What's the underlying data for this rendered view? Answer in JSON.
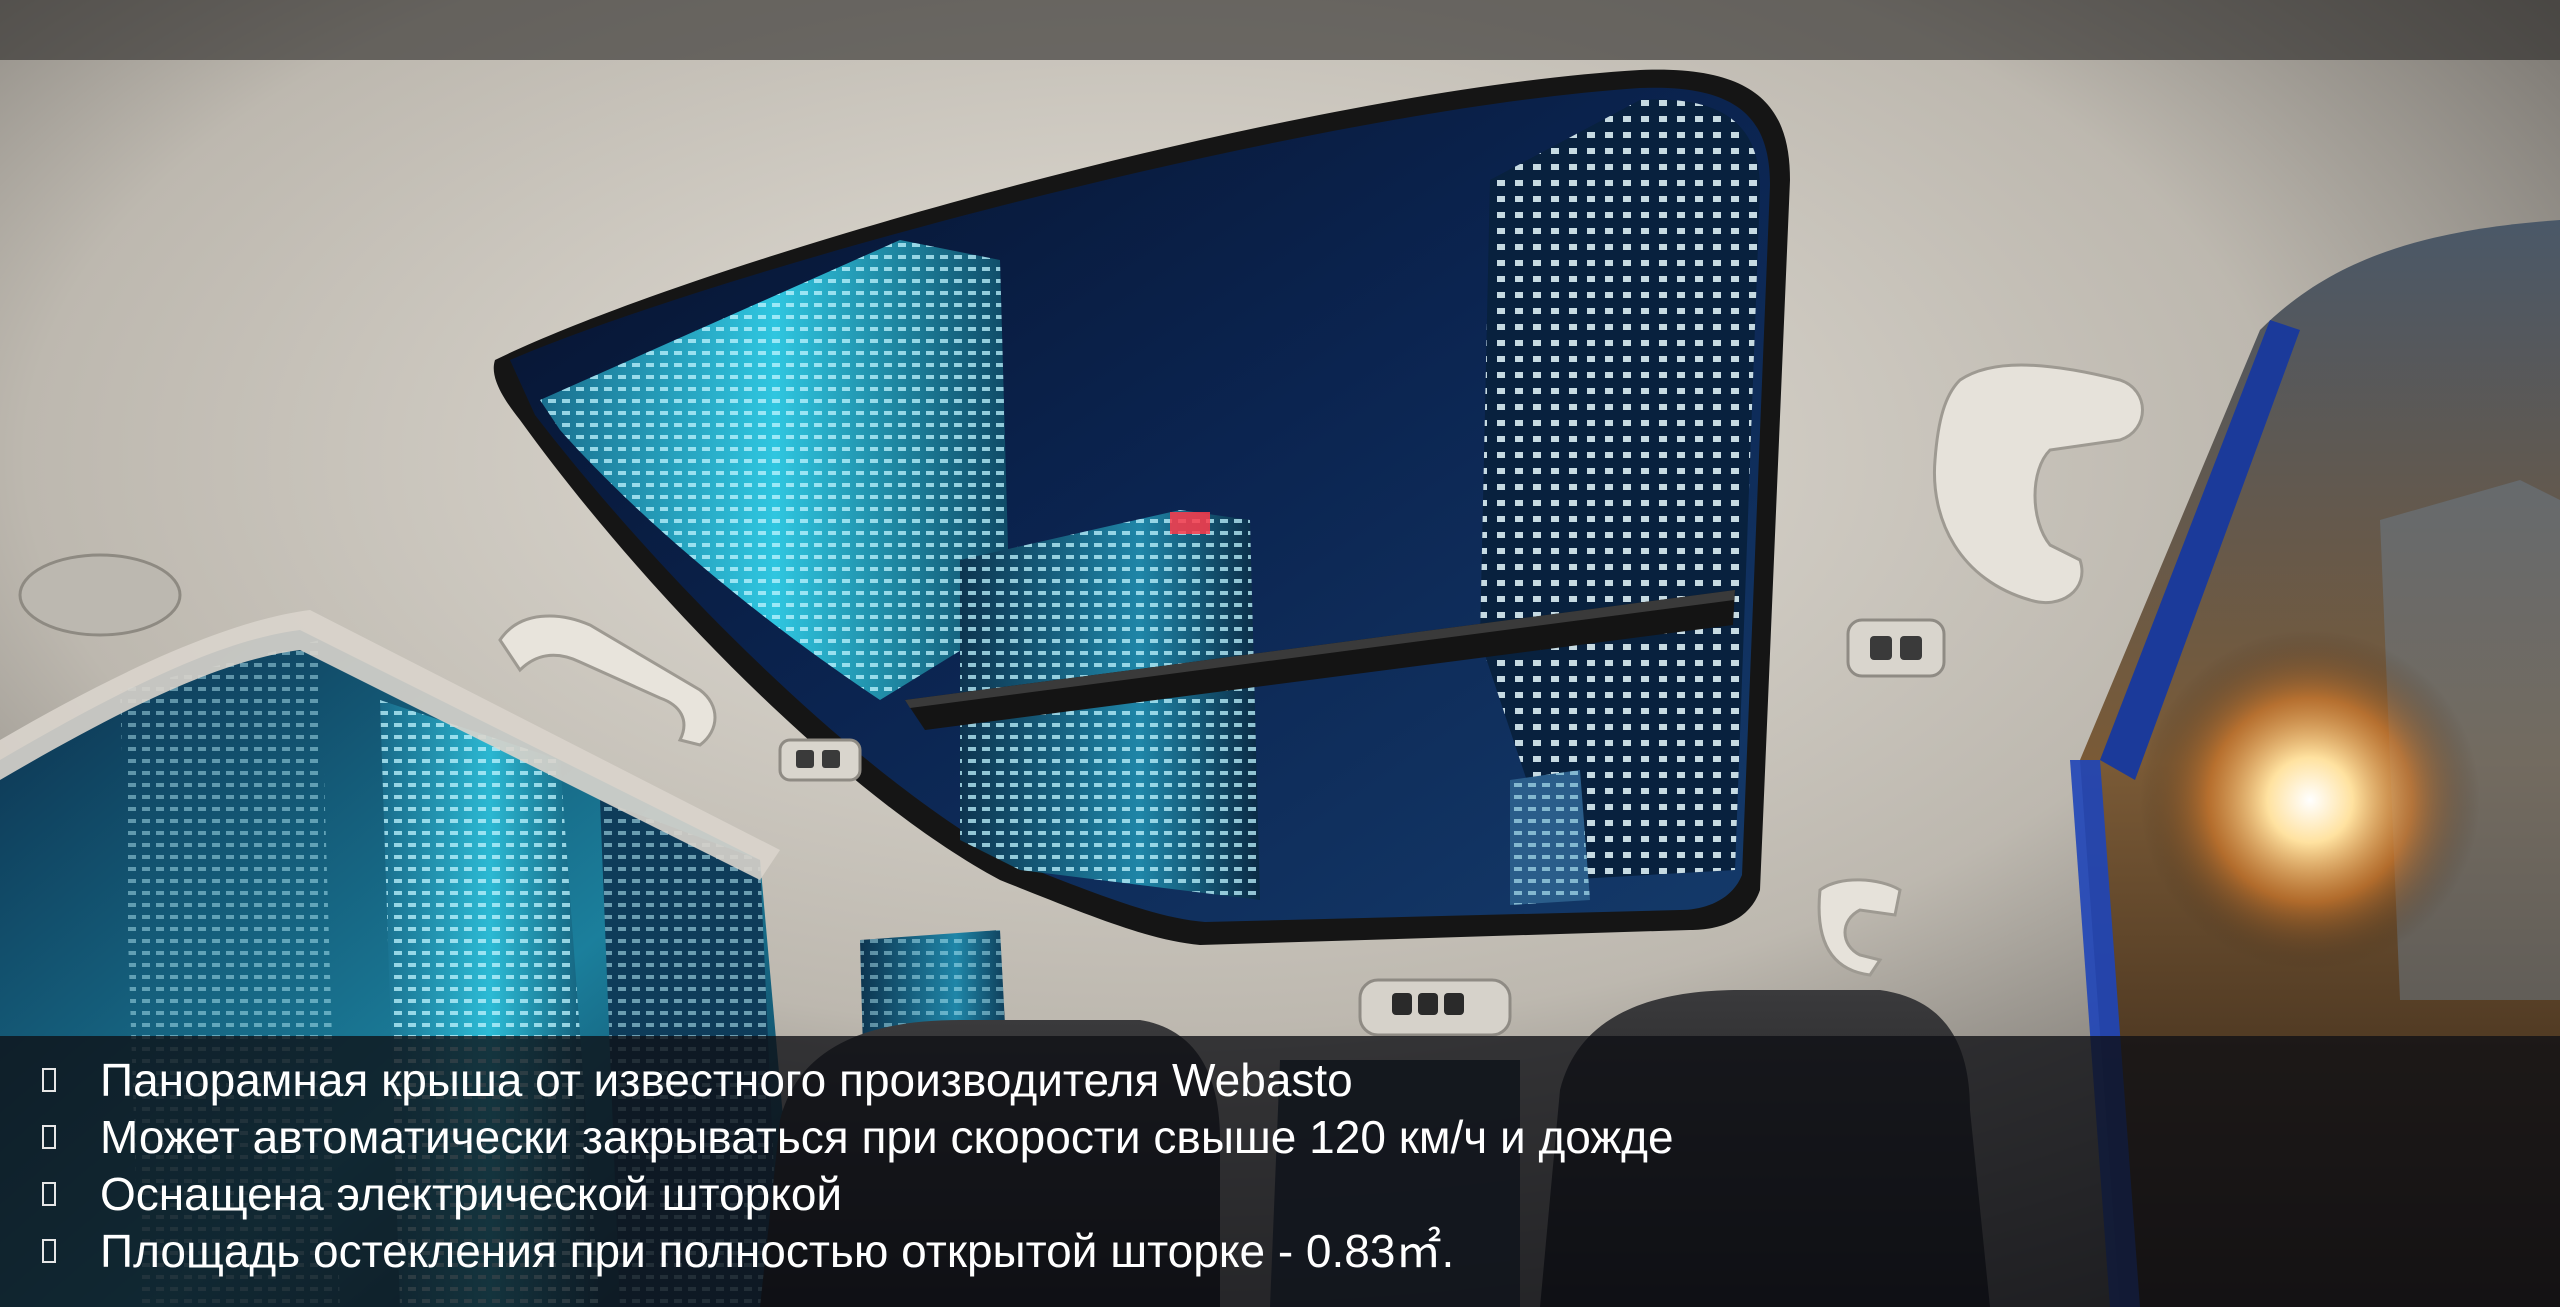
{
  "colors": {
    "caption_background": "#0e1014",
    "caption_text": "#ffffff",
    "headliner": "#cfcac2",
    "night_sky": "#0b1e3f",
    "building_glow": "#2fc6e0",
    "street_light": "#ffb347"
  },
  "bullets": [
    {
      "icon": "square-bullet-icon",
      "text": "Панорамная крыша от известного производителя Webasto"
    },
    {
      "icon": "square-bullet-icon",
      "text": "Может автоматически закрываться при скорости свыше 120 км/ч и дожде"
    },
    {
      "icon": "square-bullet-icon",
      "text": "Оснащена электрической шторкой"
    },
    {
      "icon": "square-bullet-icon",
      "text": "Площадь остекления при полностью открытой шторке - 0.83㎡."
    }
  ]
}
